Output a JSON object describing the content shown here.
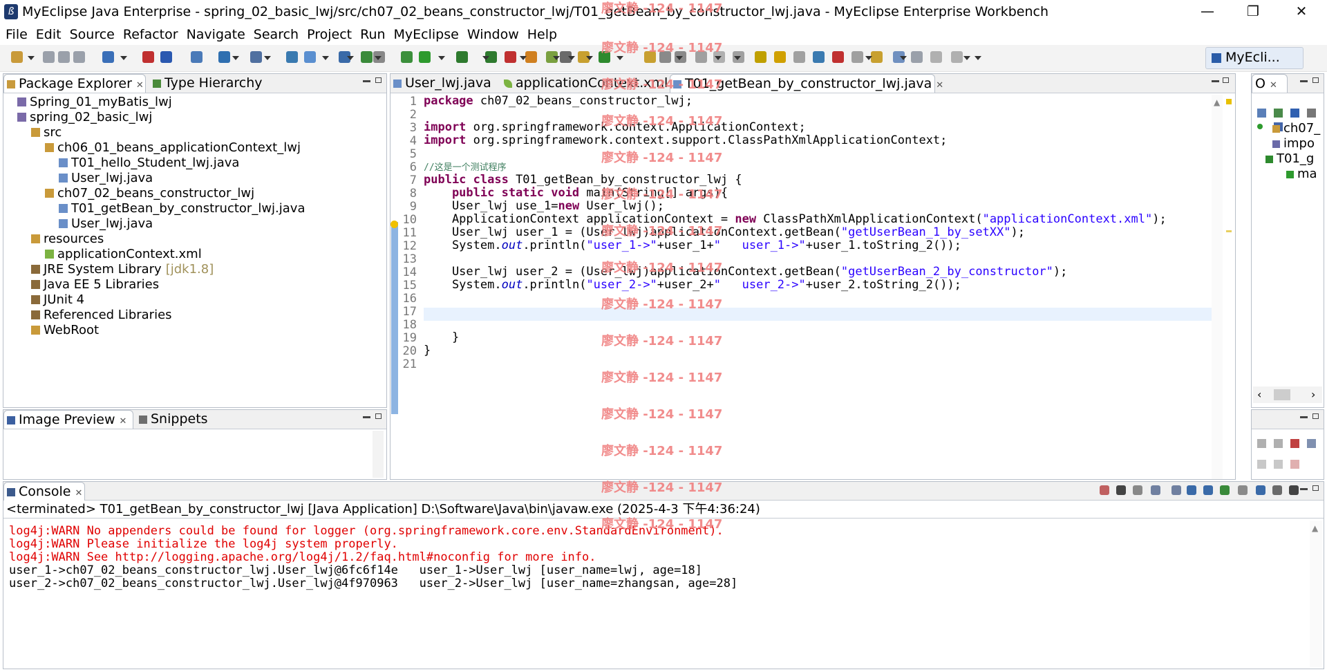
{
  "window": {
    "title": "MyEclipse Java Enterprise - spring_02_basic_lwj/src/ch07_02_beans_constructor_lwj/T01_getBean_by_constructor_lwj.java - MyEclipse Enterprise Workbench",
    "min": "—",
    "max": "❐",
    "close": "✕"
  },
  "menu": [
    "File",
    "Edit",
    "Source",
    "Refactor",
    "Navigate",
    "Search",
    "Project",
    "Run",
    "MyEclipse",
    "Window",
    "Help"
  ],
  "perspective": {
    "label": "MyEcli..."
  },
  "package_explorer": {
    "tab_label": "Package Explorer",
    "tab2_label": "Type Hierarchy",
    "items": [
      {
        "label": "Spring_01_myBatis_lwj"
      },
      {
        "label": "spring_02_basic_lwj"
      },
      {
        "label": "src"
      },
      {
        "label": "ch06_01_beans_applicationContext_lwj"
      },
      {
        "label": "T01_hello_Student_lwj.java"
      },
      {
        "label": "User_lwj.java"
      },
      {
        "label": "ch07_02_beans_constructor_lwj"
      },
      {
        "label": "T01_getBean_by_constructor_lwj.java"
      },
      {
        "label": "User_lwj.java"
      },
      {
        "label": "resources"
      },
      {
        "label": "applicationContext.xml"
      },
      {
        "label": "JRE System Library",
        "extra": "[jdk1.8]"
      },
      {
        "label": "Java EE 5 Libraries"
      },
      {
        "label": "JUnit 4"
      },
      {
        "label": "Referenced Libraries"
      },
      {
        "label": "WebRoot"
      }
    ]
  },
  "preview": {
    "tab_label": "Image Preview",
    "tab2_label": "Snippets"
  },
  "editor": {
    "tabs": [
      {
        "label": "User_lwj.java"
      },
      {
        "label": "applicationContext.xml"
      },
      {
        "label": "T01_getBean_by_constructor_lwj.java"
      }
    ],
    "line_numbers": [
      "1",
      "2",
      "3",
      "4",
      "5",
      "6",
      "7",
      "8",
      "9",
      "10",
      "11",
      "12",
      "13",
      "14",
      "15",
      "16",
      "17",
      "18",
      "19",
      "20",
      "21"
    ],
    "lines": [
      {
        "kw": "package ",
        "t1": "ch07_02_beans_constructor_lwj;"
      },
      {},
      {
        "kw": "import ",
        "t1": "org.springframework.context.ApplicationContext;"
      },
      {
        "kw": "import ",
        "t1": "org.springframework.context.support.ClassPathXmlApplicationContext;"
      },
      {},
      {
        "cmt": "//这是一个测试程序"
      },
      {
        "kw": "public class ",
        "t1": "T01_getBean_by_constructor_lwj {"
      },
      {
        "kw": "    public static void ",
        "t1": "main(String[] args){"
      },
      {
        "t0": "    User_lwj use_1=",
        "kw": "new ",
        "t1": "User_lwj();"
      },
      {
        "t0": "    ApplicationContext applicationContext = ",
        "kw": "new ",
        "t1": "ClassPathXmlApplicationContext(",
        "str": "\"applicationContext.xml\"",
        "t2": ");"
      },
      {
        "t0": "    User_lwj user_1 = (User_lwj)applicationContext.getBean(",
        "str": "\"getUserBean_1_by_setXX\"",
        "t2": ");"
      },
      {
        "t0": "    System.",
        "it": "out",
        "t1": ".println(",
        "str": "\"user_1->\"",
        "t2": "+user_1+",
        "str2": "\"   user_1->\"",
        "t3": "+user_1.toString_2());"
      },
      {},
      {
        "t0": "    User_lwj user_2 = (User_lwj)applicationContext.getBean(",
        "str": "\"getUserBean_2_by_constructor\"",
        "t2": ");"
      },
      {
        "t0": "    System.",
        "it": "out",
        "t1": ".println(",
        "str": "\"user_2->\"",
        "t2": "+user_2+",
        "str2": "\"   user_2->\"",
        "t3": "+user_2.toString_2());"
      },
      {},
      {},
      {},
      {
        "t0": "    }"
      },
      {
        "t0": "}"
      },
      {}
    ]
  },
  "outline": {
    "tab_label": "O",
    "items": [
      {
        "label": "ch07_"
      },
      {
        "label": "impo"
      },
      {
        "label": "T01_g"
      },
      {
        "label": "ma"
      }
    ]
  },
  "console": {
    "tab_label": "Console",
    "header": "<terminated> T01_getBean_by_constructor_lwj [Java Application] D:\\Software\\Java\\bin\\javaw.exe (2025-4-3 下午4:36:24)",
    "lines": [
      {
        "text": "log4j:WARN No appenders could be found for logger (org.springframework.core.env.StandardEnvironment).",
        "err": true
      },
      {
        "text": "log4j:WARN Please initialize the log4j system properly.",
        "err": true
      },
      {
        "text": "log4j:WARN See http://logging.apache.org/log4j/1.2/faq.html#noconfig for more info.",
        "err": true
      },
      {
        "text": "user_1->ch07_02_beans_constructor_lwj.User_lwj@6fc6f14e   user_1->User_lwj [user_name=lwj, age=18]",
        "err": false
      },
      {
        "text": "user_2->ch07_02_beans_constructor_lwj.User_lwj@4f970963   user_2->User_lwj [user_name=zhangsan, age=28]",
        "err": false
      }
    ]
  },
  "watermark": "廖文静 -124 - 1147",
  "colors": {
    "keyword": "#7f0055",
    "string": "#2a00ff",
    "comment": "#3f7f5f",
    "error": "#e00000",
    "current_line": "#e8f2fe"
  }
}
